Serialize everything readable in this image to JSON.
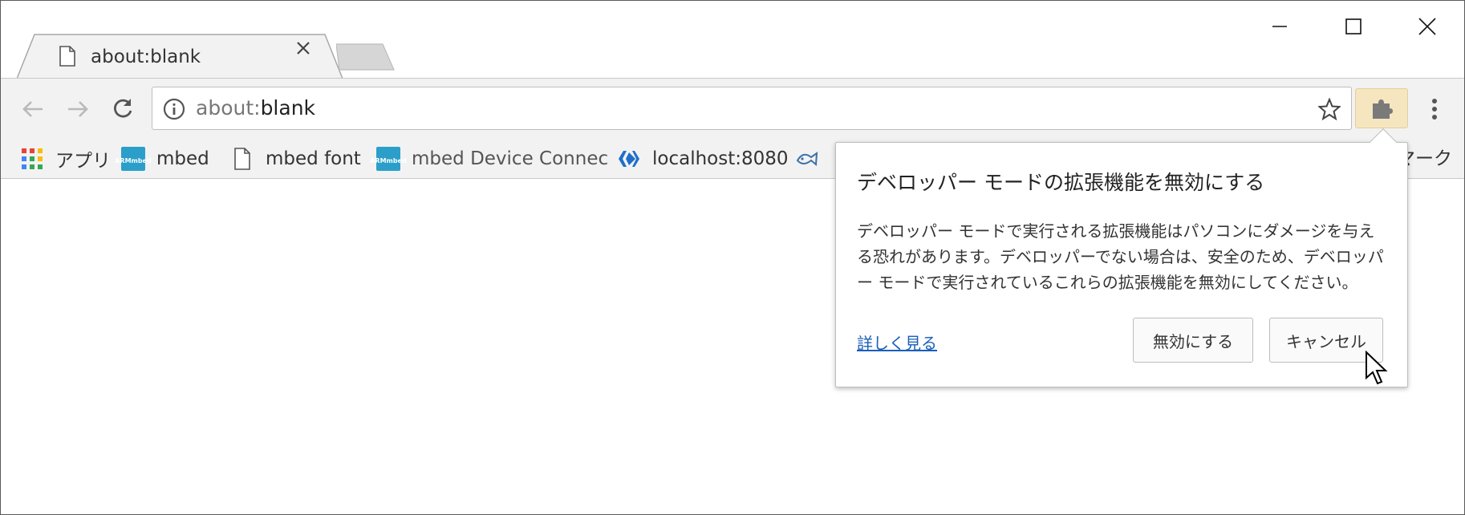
{
  "tab": {
    "title": "about:blank"
  },
  "omnibox": {
    "scheme": "about:",
    "host": "blank"
  },
  "bookmarks": [
    {
      "label": "アプリ",
      "icon": "apps-grid-icon"
    },
    {
      "label": "mbed",
      "icon": "arm-mbed-icon"
    },
    {
      "label": "mbed font",
      "icon": "page-icon"
    },
    {
      "label": "mbed Device Connec",
      "icon": "arm-mbed-icon"
    },
    {
      "label": "localhost:8080",
      "icon": "diamond-arrows-icon"
    },
    {
      "label": "",
      "icon": "fish-icon"
    }
  ],
  "bookmarks_overflow": "マーク",
  "arm_logo": {
    "line1": "ARM",
    "line2": "mbed"
  },
  "bubble": {
    "title": "デベロッパー モードの拡張機能を無効にする",
    "body": "デベロッパー モードで実行される拡張機能はパソコンにダメージを与える恐れがあります。デベロッパーでない場合は、安全のため、デベロッパー モードで実行されているこれらの拡張機能を無効にしてください。",
    "learn_more": "詳しく見る",
    "disable_label": "無効にする",
    "cancel_label": "キャンセル"
  },
  "colors": {
    "toolbar_bg": "#f2f2f2",
    "extension_highlight": "#f5e6c0",
    "link": "#1a5eb8"
  }
}
